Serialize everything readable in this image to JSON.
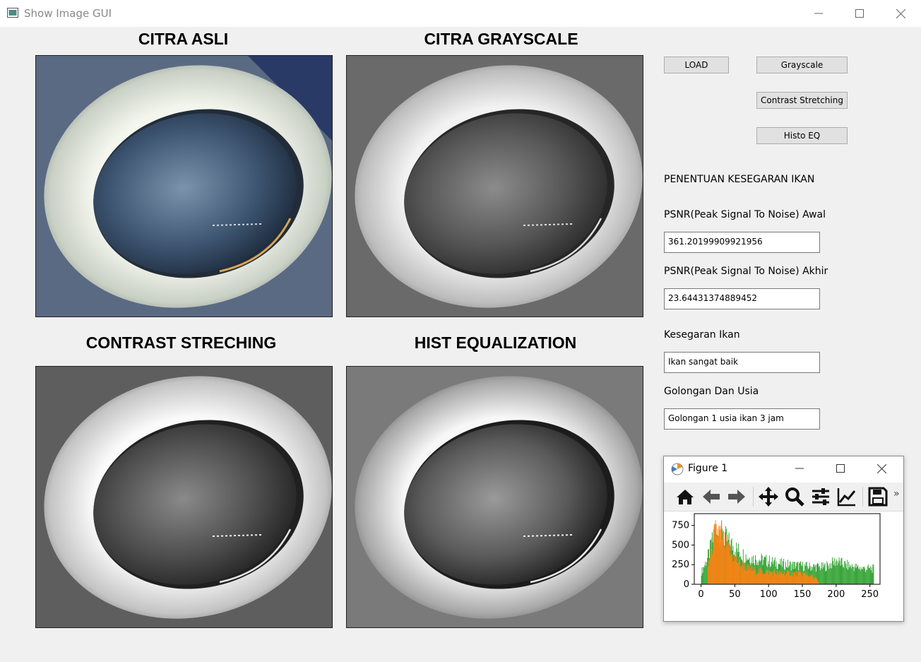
{
  "window": {
    "title": "Show Image GUI",
    "icons": [
      "app-icon",
      "minimize-icon",
      "maximize-icon",
      "close-icon"
    ]
  },
  "panels": {
    "original": {
      "title": "CITRA ASLI"
    },
    "grayscale": {
      "title": "CITRA GRAYSCALE"
    },
    "contrast": {
      "title": "CONTRAST STRECHING"
    },
    "histeq": {
      "title": "HIST EQUALIZATION"
    }
  },
  "buttons": {
    "load": "LOAD",
    "grayscale": "Grayscale",
    "contrast": "Contrast Stretching",
    "histeq": "Histo EQ"
  },
  "info": {
    "heading": "PENENTUAN KESEGARAN IKAN",
    "psnr_awal_label": "PSNR(Peak Signal To Noise) Awal",
    "psnr_awal_value": "361.20199909921956",
    "psnr_akhir_label": "PSNR(Peak Signal To Noise) Akhir",
    "psnr_akhir_value": "23.64431374889452",
    "kesegaran_label": "Kesegaran Ikan",
    "kesegaran_value": "Ikan sangat baik",
    "golongan_label": "Golongan Dan Usia",
    "golongan_value": "Golongan 1 usia ikan 3 jam"
  },
  "figure": {
    "title": "Figure 1",
    "toolbar": [
      "home-icon",
      "back-icon",
      "forward-icon",
      "pan-icon",
      "zoom-icon",
      "subplots-icon",
      "axes-edit-icon",
      "save-icon"
    ],
    "more": "»"
  },
  "chart_data": {
    "type": "bar",
    "xlim": [
      -10,
      265
    ],
    "ylim": [
      0,
      900
    ],
    "xticks": [
      0,
      50,
      100,
      150,
      200,
      250
    ],
    "yticks": [
      0,
      250,
      500,
      750
    ],
    "series": [
      {
        "color": "#2ca02c",
        "points": [
          [
            0,
            200
          ],
          [
            10,
            450
          ],
          [
            15,
            650
          ],
          [
            20,
            820
          ],
          [
            25,
            880
          ],
          [
            30,
            820
          ],
          [
            35,
            760
          ],
          [
            40,
            690
          ],
          [
            50,
            600
          ],
          [
            60,
            500
          ],
          [
            70,
            440
          ],
          [
            80,
            420
          ],
          [
            90,
            400
          ],
          [
            100,
            380
          ],
          [
            110,
            350
          ],
          [
            120,
            330
          ],
          [
            130,
            320
          ],
          [
            140,
            310
          ],
          [
            150,
            300
          ],
          [
            160,
            290
          ],
          [
            170,
            290
          ],
          [
            180,
            280
          ],
          [
            190,
            320
          ],
          [
            200,
            390
          ],
          [
            210,
            330
          ],
          [
            220,
            300
          ],
          [
            230,
            280
          ],
          [
            240,
            260
          ],
          [
            250,
            260
          ],
          [
            255,
            255
          ]
        ]
      },
      {
        "color": "#ff7f0e",
        "points": [
          [
            10,
            300
          ],
          [
            15,
            600
          ],
          [
            20,
            840
          ],
          [
            25,
            870
          ],
          [
            30,
            800
          ],
          [
            35,
            680
          ],
          [
            40,
            560
          ],
          [
            50,
            420
          ],
          [
            60,
            320
          ],
          [
            70,
            260
          ],
          [
            80,
            230
          ],
          [
            90,
            210
          ],
          [
            100,
            200
          ],
          [
            110,
            190
          ],
          [
            120,
            185
          ],
          [
            130,
            180
          ],
          [
            140,
            180
          ],
          [
            150,
            175
          ],
          [
            160,
            150
          ],
          [
            170,
            100
          ],
          [
            175,
            0
          ]
        ]
      }
    ],
    "grid": false,
    "legend": "none"
  }
}
